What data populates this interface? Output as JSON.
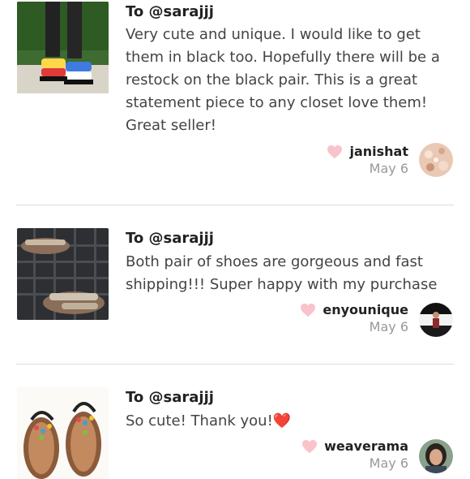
{
  "reviews": [
    {
      "to": "To @sarajjj",
      "text": "Very cute and unique. I would like to get them in black too. Hopefully there will be a restock on the black pair. This is a great statement piece to any closet love them! Great seller!",
      "user": "janishat",
      "date": "May 6",
      "thumb_icon": "platform-sandals-photo",
      "avatar_icon": "rose-gold-glitter-avatar"
    },
    {
      "to": "To @sarajjj",
      "text": "Both pair of shoes are gorgeous and fast shipping!!! Super happy with my purchase",
      "user": "enyounique",
      "date": "May 6",
      "thumb_icon": "glitter-sandals-photo",
      "avatar_icon": "person-avatar"
    },
    {
      "to": "To @sarajjj",
      "text": "So cute! Thank you!❤️",
      "user": "weaverama",
      "date": "May 6",
      "thumb_icon": "beaded-sandals-photo",
      "avatar_icon": "woman-avatar"
    }
  ],
  "colors": {
    "heart": "#f9c3cb",
    "divider": "#dcdcdc",
    "date": "#999999"
  }
}
